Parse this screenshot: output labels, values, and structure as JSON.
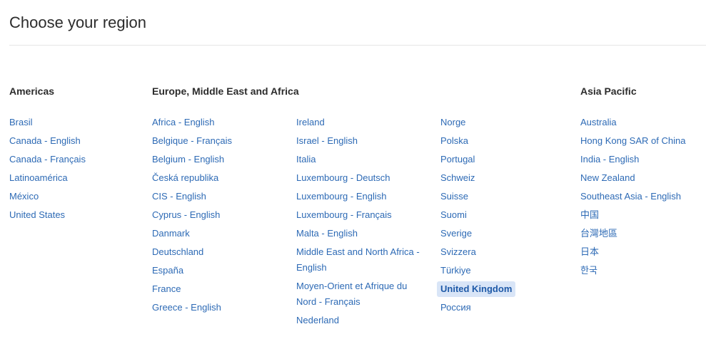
{
  "title": "Choose your region",
  "colors": {
    "link": "#2d6ab5",
    "heading": "#2c2c2c",
    "selected_bg": "#d9e5f7"
  },
  "sections": {
    "americas": {
      "heading": "Americas",
      "items": [
        "Brasil",
        "Canada - English",
        "Canada - Français",
        "Latinoamérica",
        "México",
        "United States"
      ]
    },
    "emea": {
      "heading": "Europe, Middle East and Africa",
      "col1": [
        "Africa - English",
        "Belgique - Français",
        "Belgium - English",
        "Česká republika",
        "CIS - English",
        "Cyprus - English",
        "Danmark",
        "Deutschland",
        "España",
        "France",
        "Greece - English"
      ],
      "col2": [
        "Ireland",
        "Israel - English",
        "Italia",
        "Luxembourg - Deutsch",
        "Luxembourg - English",
        "Luxembourg - Français",
        "Malta - English",
        "Middle East and North Africa - English",
        "Moyen-Orient et Afrique du Nord - Français",
        "Nederland"
      ],
      "col3": [
        "Norge",
        "Polska",
        "Portugal",
        "Schweiz",
        "Suisse",
        "Suomi",
        "Sverige",
        "Svizzera",
        "Türkiye",
        "United Kingdom",
        "Россия"
      ]
    },
    "apac": {
      "heading": "Asia Pacific",
      "items": [
        "Australia",
        "Hong Kong SAR of China",
        "India - English",
        "New Zealand",
        "Southeast Asia - English",
        "中国",
        "台灣地區",
        "日本",
        "한국"
      ]
    }
  },
  "selected_region": "United Kingdom"
}
